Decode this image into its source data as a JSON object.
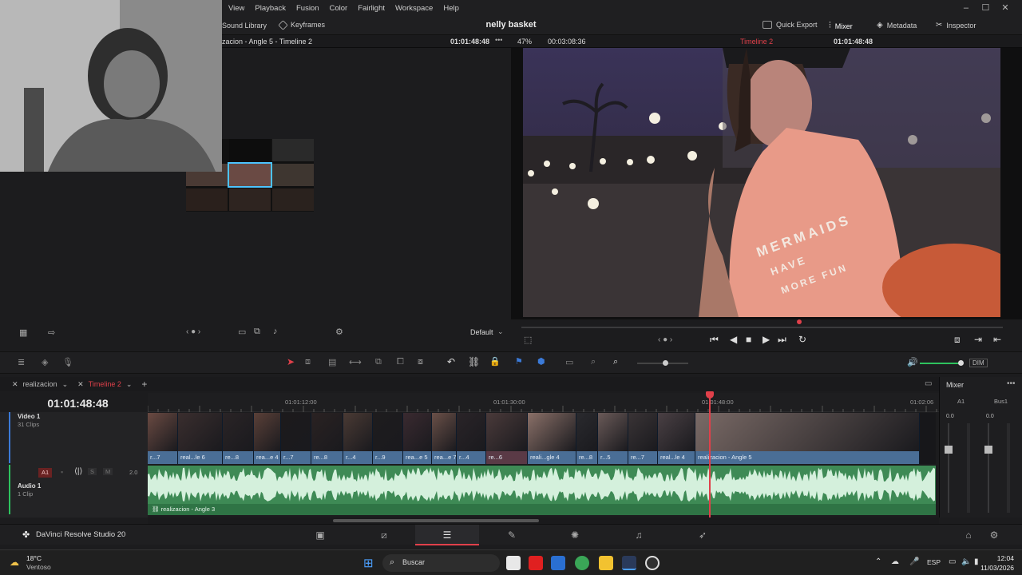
{
  "menu": [
    "View",
    "Playback",
    "Fusion",
    "Color",
    "Fairlight",
    "Workspace",
    "Help"
  ],
  "project_title": "nelly basket",
  "toolbar": {
    "sound_library": "Sound Library",
    "keyframes": "Keyframes",
    "quick_export": "Quick Export",
    "mixer": "Mixer",
    "metadata": "Metadata",
    "inspector": "Inspector"
  },
  "source_viewer": {
    "title": "zacion - Angle 5 - Timeline 2",
    "timecode": "01:01:48:48",
    "zoom": "47%",
    "duration": "00:03:08:36"
  },
  "record_viewer": {
    "timeline_name": "Timeline 2",
    "timecode": "01:01:48:48"
  },
  "video_text": "MERMAIDS HAVE MORE FUN",
  "source_controls": {
    "default_label": "Default"
  },
  "tabs": {
    "tab1": "realizacion",
    "tab2": "Timeline 2"
  },
  "timeline": {
    "timecode": "01:01:48:48",
    "ruler": [
      "01:01:12:00",
      "01:01:30:00",
      "01:01:48:00",
      "01:02:06"
    ]
  },
  "tracks": {
    "video": {
      "name": "Video 1",
      "count": "31 Clips"
    },
    "audio": {
      "badge": "A1",
      "name": "Audio 1",
      "count": "1 Clip",
      "s": "S",
      "m": "M",
      "level": "2.0",
      "clip_label": "realizacion - Angle 3"
    }
  },
  "video_clips": [
    "r...7",
    "real...le 6",
    "re...8",
    "rea...e 4",
    "r...7",
    "re...8",
    "r...4",
    "r...9",
    "rea...e 5",
    "rea...e 7",
    "r...4",
    "re...6",
    "reali...gle 4",
    "re...8",
    "r...5",
    "re...7",
    "real...le 4",
    "realizacion - Angle 5"
  ],
  "mixer": {
    "title": "Mixer",
    "ch1": "A1",
    "ch2": "Bus1",
    "val1": "0.0",
    "val2": "0.0"
  },
  "dim": "DIM",
  "app_name": "DaVinci Resolve Studio 20",
  "taskbar": {
    "temp": "18°C",
    "weather": "Ventoso",
    "search": "Buscar",
    "lang": "ESP",
    "time": "12:04",
    "date": "11/03/2026"
  },
  "colors": {
    "clip_blue": "#4a6e96",
    "audio_green": "#3e8a55",
    "playhead": "#e0404a",
    "timeline_tab": "#e0404a"
  }
}
